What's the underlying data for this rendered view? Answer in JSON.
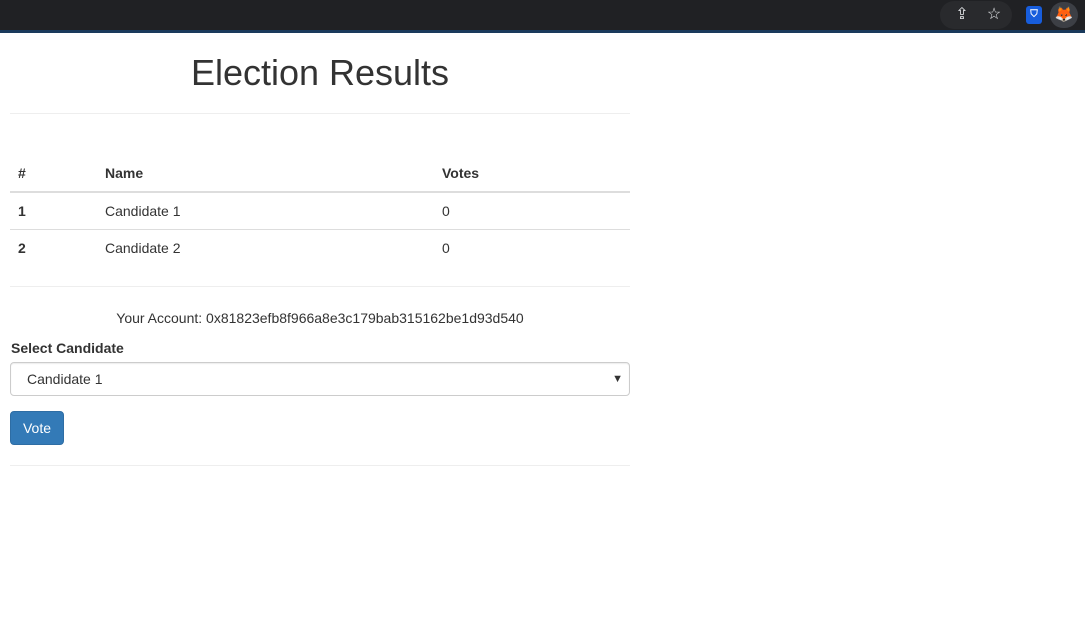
{
  "browser": {
    "share_icon": "share-icon",
    "star_icon": "star-icon",
    "extensions": [
      "bitwarden",
      "metamask"
    ]
  },
  "page": {
    "title": "Election Results",
    "table": {
      "headers": [
        "#",
        "Name",
        "Votes"
      ],
      "rows": [
        [
          "1",
          "Candidate 1",
          "0"
        ],
        [
          "2",
          "Candidate 2",
          "0"
        ]
      ]
    },
    "account": "Your Account: 0x81823efb8f966a8e3c179bab315162be1d93d540",
    "select_label": "Select Candidate",
    "select_value": "Candidate 1",
    "vote_label": "Vote"
  },
  "colors": {
    "accent": "#337ab7"
  }
}
